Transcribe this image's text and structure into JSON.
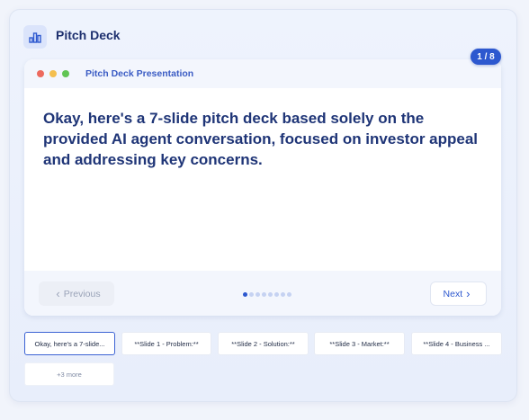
{
  "header": {
    "title": "Pitch Deck",
    "icon": "bar-chart-icon"
  },
  "badge": {
    "page_indicator": "1 / 8"
  },
  "window": {
    "title": "Pitch Deck Presentation"
  },
  "slide": {
    "text": "Okay, here's a 7-slide pitch deck based solely on the provided AI agent conversation, focused on investor appeal and addressing key concerns."
  },
  "nav": {
    "previous_label": "Previous",
    "next_label": "Next",
    "current_index": 1,
    "total": 8
  },
  "thumbnails": [
    {
      "label": "Okay, here's a 7-slide...",
      "active": true
    },
    {
      "label": "**Slide 1 - Problem:**",
      "active": false
    },
    {
      "label": "**Slide 2 - Solution:**",
      "active": false
    },
    {
      "label": "**Slide 3 - Market:**",
      "active": false
    },
    {
      "label": "**Slide 4 - Business ...",
      "active": false
    }
  ],
  "more_label": "+3 more",
  "colors": {
    "accent": "#2d58cf",
    "title": "#1f3577"
  }
}
